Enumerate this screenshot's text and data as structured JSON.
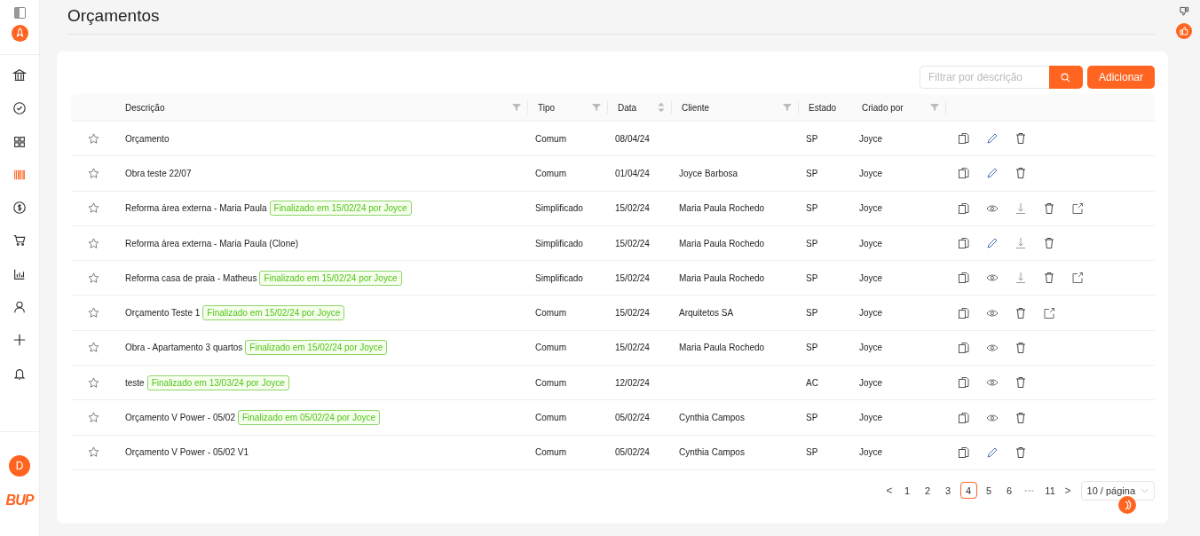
{
  "sidebar": {
    "items": [
      {
        "kind": "bank",
        "selected": false
      },
      {
        "kind": "check-circle",
        "selected": false
      },
      {
        "kind": "grid",
        "selected": false
      },
      {
        "kind": "barcode",
        "selected": true
      },
      {
        "kind": "dollar",
        "selected": false
      },
      {
        "kind": "cart",
        "selected": false
      },
      {
        "kind": "chart",
        "selected": false
      },
      {
        "kind": "user",
        "selected": false
      },
      {
        "kind": "plus",
        "selected": false
      },
      {
        "kind": "bell",
        "selected": false
      }
    ],
    "avatar": "D",
    "logo": "BUP"
  },
  "page": {
    "title": "Orçamentos"
  },
  "toolbar": {
    "search": {
      "placeholder": "Filtrar por descrição"
    },
    "add_button": "Adicionar"
  },
  "table": {
    "columns": [
      {
        "kind": "plain"
      },
      {
        "label": "Descrição",
        "kind": "filter"
      },
      {
        "label": "Tipo",
        "kind": "filter"
      },
      {
        "label": "Data",
        "kind": "sort"
      },
      {
        "label": "Cliente",
        "kind": "filter"
      },
      {
        "label": "Estado",
        "kind": "plain"
      },
      {
        "label": "Criado por",
        "kind": "filter"
      },
      {
        "kind": "plain"
      }
    ],
    "rows": [
      {
        "starred": false,
        "description": "Orçamento",
        "type": "Comum",
        "date": "08/04/24",
        "state": "SP",
        "created_by": "Joyce",
        "actions": [
          {
            "kind": "copy"
          },
          {
            "kind": "edit"
          },
          {
            "kind": "delete"
          }
        ]
      },
      {
        "starred": false,
        "description": "Obra teste 22/07",
        "type": "Comum",
        "date": "01/04/24",
        "client": "Joyce Barbosa",
        "state": "SP",
        "created_by": "Joyce",
        "actions": [
          {
            "kind": "copy"
          },
          {
            "kind": "edit"
          },
          {
            "kind": "delete"
          }
        ]
      },
      {
        "starred": false,
        "description": "Reforma área externa - Maria Paula",
        "tag": "Finalizado em 15/02/24 por Joyce",
        "type": "Simplificado",
        "date": "15/02/24",
        "client": "Maria Paula Rochedo",
        "state": "SP",
        "created_by": "Joyce",
        "actions": [
          {
            "kind": "copy"
          },
          {
            "kind": "view"
          },
          {
            "kind": "download"
          },
          {
            "kind": "delete"
          },
          {
            "kind": "share"
          }
        ]
      },
      {
        "starred": false,
        "description": "Reforma área externa - Maria Paula (Clone)",
        "type": "Simplificado",
        "date": "15/02/24",
        "client": "Maria Paula Rochedo",
        "state": "SP",
        "created_by": "Joyce",
        "actions": [
          {
            "kind": "copy"
          },
          {
            "kind": "edit"
          },
          {
            "kind": "download"
          },
          {
            "kind": "delete"
          }
        ]
      },
      {
        "starred": false,
        "description": "Reforma casa de praia - Matheus",
        "tag": "Finalizado em 15/02/24 por Joyce",
        "type": "Simplificado",
        "date": "15/02/24",
        "client": "Maria Paula Rochedo",
        "state": "SP",
        "created_by": "Joyce",
        "actions": [
          {
            "kind": "copy"
          },
          {
            "kind": "view"
          },
          {
            "kind": "download"
          },
          {
            "kind": "delete"
          },
          {
            "kind": "share"
          }
        ]
      },
      {
        "starred": false,
        "description": "Orçamento Teste 1",
        "tag": "Finalizado em 15/02/24 por Joyce",
        "type": "Comum",
        "date": "15/02/24",
        "client": "Arquitetos SA",
        "state": "SP",
        "created_by": "Joyce",
        "actions": [
          {
            "kind": "copy"
          },
          {
            "kind": "view"
          },
          {
            "kind": "delete"
          },
          {
            "kind": "share"
          }
        ]
      },
      {
        "starred": false,
        "description": "Obra - Apartamento 3 quartos",
        "tag": "Finalizado em 15/02/24 por Joyce",
        "type": "Comum",
        "date": "15/02/24",
        "client": "Maria Paula Rochedo",
        "state": "SP",
        "created_by": "Joyce",
        "actions": [
          {
            "kind": "copy"
          },
          {
            "kind": "view"
          },
          {
            "kind": "delete"
          }
        ]
      },
      {
        "starred": false,
        "description": "teste",
        "tag": "Finalizado em 13/03/24 por Joyce",
        "type": "Comum",
        "date": "12/02/24",
        "state": "AC",
        "created_by": "Joyce",
        "actions": [
          {
            "kind": "copy"
          },
          {
            "kind": "view"
          },
          {
            "kind": "delete"
          }
        ]
      },
      {
        "starred": false,
        "description": "Orçamento V Power - 05/02",
        "tag": "Finalizado em 05/02/24 por Joyce",
        "type": "Comum",
        "date": "05/02/24",
        "client": "Cynthia Campos",
        "state": "SP",
        "created_by": "Joyce",
        "actions": [
          {
            "kind": "copy"
          },
          {
            "kind": "view"
          },
          {
            "kind": "delete"
          }
        ]
      },
      {
        "starred": false,
        "description": "Orçamento V Power - 05/02 V1",
        "type": "Comum",
        "date": "05/02/24",
        "client": "Cynthia Campos",
        "state": "SP",
        "created_by": "Joyce",
        "actions": [
          {
            "kind": "copy"
          },
          {
            "kind": "edit"
          },
          {
            "kind": "delete"
          }
        ]
      }
    ]
  },
  "pagination": {
    "prev": "<",
    "pages": [
      {
        "label": "1",
        "kind": "page",
        "selected": false
      },
      {
        "label": "2",
        "kind": "page",
        "selected": false
      },
      {
        "label": "3",
        "kind": "page",
        "selected": false
      },
      {
        "label": "4",
        "kind": "page",
        "selected": true
      },
      {
        "label": "5",
        "kind": "page",
        "selected": false
      },
      {
        "label": "6",
        "kind": "page",
        "selected": false
      },
      {
        "label": "•••",
        "kind": "ellipsis",
        "selected": false
      },
      {
        "label": "11",
        "kind": "page",
        "selected": false
      }
    ],
    "next": ">",
    "page_size": "10 / página"
  }
}
